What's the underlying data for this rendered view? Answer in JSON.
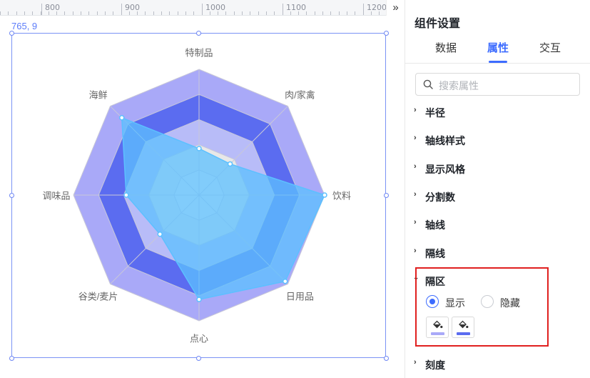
{
  "ruler": {
    "labels": [
      "800",
      "900",
      "1000",
      "1100",
      "1200"
    ],
    "expand_icon": "double-chevron-right-icon"
  },
  "canvas": {
    "coordinate_text": "765, 9"
  },
  "chart_data": {
    "type": "radar",
    "indicators": [
      "特制品",
      "肉/家禽",
      "饮料",
      "日用品",
      "点心",
      "谷类/麦片",
      "调味品",
      "海鲜"
    ],
    "max": 100,
    "split_number": 5,
    "split_area": true,
    "split_area_colors": [
      "#efefef",
      "#e8e8e8",
      "#b8bcf8",
      "#5b6cf0",
      "#a9a9f8"
    ],
    "series": [
      {
        "values": [
          37,
          35,
          100,
          97,
          83,
          44,
          58,
          87
        ]
      }
    ],
    "series_color": "#5cc0ff"
  },
  "panel": {
    "title": "组件设置",
    "tabs": [
      {
        "label": "数据",
        "active": false
      },
      {
        "label": "属性",
        "active": true
      },
      {
        "label": "交互",
        "active": false
      }
    ],
    "search_placeholder": "搜索属性",
    "sections": {
      "radius": "半径",
      "axis_line_style": "轴线样式",
      "display_style": "显示风格",
      "split_number": "分割数",
      "axis_line": "轴线",
      "split_line": "隔线",
      "split_area": "隔区",
      "tick": "刻度"
    },
    "split_area_options": {
      "show": "显示",
      "hide": "隐藏",
      "selected": "显示"
    },
    "swatch_colors": [
      "#a9a9f8",
      "#5b6cf0"
    ]
  }
}
